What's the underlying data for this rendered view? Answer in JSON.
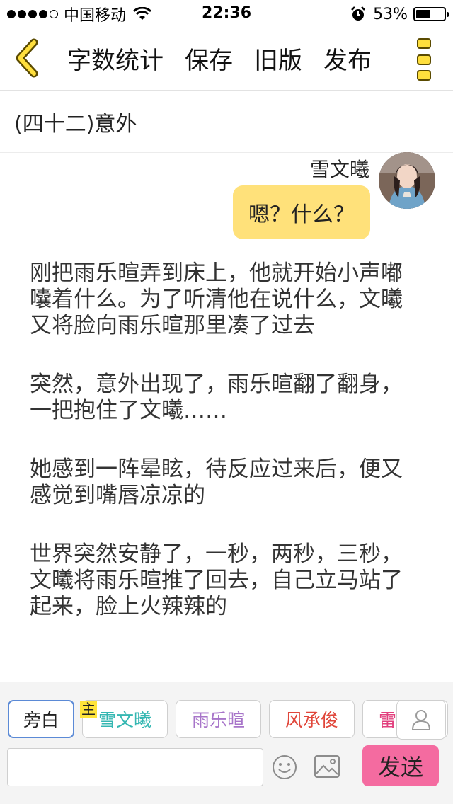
{
  "status_bar": {
    "signal_bars_filled": 4,
    "signal_bars_total": 5,
    "carrier": "中国移动",
    "time": "22:36",
    "battery": "53%",
    "battery_level": 0.53
  },
  "nav": {
    "back_icon": "back-chevron-icon",
    "links": [
      "字数统计",
      "保存",
      "旧版",
      "发布"
    ],
    "more_icon": "more-dots-icon"
  },
  "chapter": {
    "title": "(四十二)意外"
  },
  "message": {
    "speaker": "雪文曦",
    "text": "嗯？什么？"
  },
  "narration": [
    "刚把雨乐暄弄到床上，他就开始小声嘟囔着什么。为了听清他在说什么，文曦又将脸向雨乐暄那里凑了过去",
    "突然，意外出现了，雨乐暄翻了翻身，一把抱住了文曦……",
    "她感到一阵晕眩，待反应过来后，便又感觉到嘴唇凉凉的",
    "世界突然安静了，一秒，两秒，三秒，文曦将雨乐暄推了回去，自己立马站了起来，脸上火辣辣的"
  ],
  "characters": [
    {
      "label": "旁白",
      "color": "#222222",
      "selected": true
    },
    {
      "label": "雪文曦",
      "color": "#35b7b2",
      "selected": false
    },
    {
      "label": "雨乐暄",
      "color": "#a774c9",
      "selected": false
    },
    {
      "label": "风承俊",
      "color": "#e0463a",
      "selected": false
    },
    {
      "label": "雷",
      "color": "#e2407e",
      "selected": false
    }
  ],
  "main_tag": "主",
  "composer": {
    "input_value": "",
    "send_label": "发送"
  },
  "colors": {
    "bubble": "#ffe17a",
    "send": "#f46ba0",
    "accent_yellow": "#ffdf3d"
  }
}
